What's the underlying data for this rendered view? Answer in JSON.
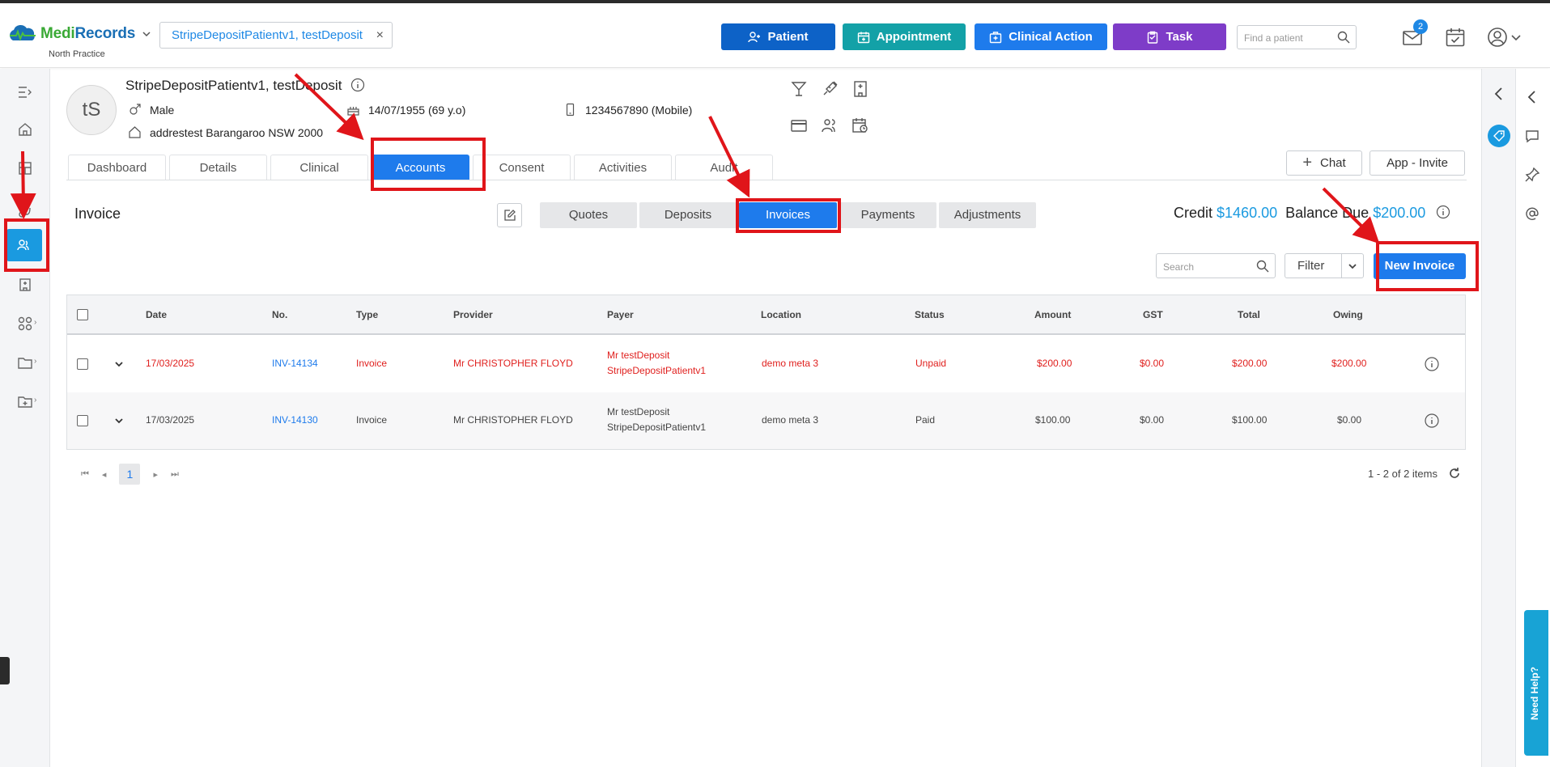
{
  "header": {
    "brand_medi": "Medi",
    "brand_records": "Records",
    "practice": "North Practice",
    "patient_chip": "StripeDepositPatientv1, testDeposit",
    "buttons": {
      "patient": "Patient",
      "appointment": "Appointment",
      "clinical_action": "Clinical Action",
      "task": "Task"
    },
    "find_placeholder": "Find a patient",
    "mail_badge": "2"
  },
  "patient": {
    "initials": "tS",
    "name": "StripeDepositPatientv1, testDeposit",
    "gender": "Male",
    "dob": "14/07/1955 (69 y.o)",
    "phone": "1234567890 (Mobile)",
    "address": "addrestest Barangaroo NSW 2000"
  },
  "tabs": [
    "Dashboard",
    "Details",
    "Clinical",
    "Accounts",
    "Consent",
    "Activities",
    "Audit"
  ],
  "active_tab": "Accounts",
  "actions": {
    "chat": "Chat",
    "app_invite": "App - Invite"
  },
  "invoice": {
    "title": "Invoice",
    "subtabs": [
      "Quotes",
      "Deposits",
      "Invoices",
      "Payments",
      "Adjustments"
    ],
    "active_subtab": "Invoices",
    "credit_label": "Credit",
    "credit_value": "$1460.00",
    "balance_label": "Balance Due",
    "balance_value": "$200.00",
    "search_placeholder": "Search",
    "filter_label": "Filter",
    "new_invoice": "New Invoice"
  },
  "table": {
    "columns": [
      "Date",
      "No.",
      "Type",
      "Provider",
      "Payer",
      "Location",
      "Status",
      "Amount",
      "GST",
      "Total",
      "Owing"
    ],
    "rows": [
      {
        "date": "17/03/2025",
        "no": "INV-14134",
        "type": "Invoice",
        "provider": "Mr CHRISTOPHER FLOYD",
        "payer_line1": "Mr testDeposit",
        "payer_line2": "StripeDepositPatientv1",
        "location": "demo meta 3",
        "status": "Unpaid",
        "amount": "$200.00",
        "gst": "$0.00",
        "total": "$200.00",
        "owing": "$200.00"
      },
      {
        "date": "17/03/2025",
        "no": "INV-14130",
        "type": "Invoice",
        "provider": "Mr CHRISTOPHER FLOYD",
        "payer_line1": "Mr testDeposit",
        "payer_line2": "StripeDepositPatientv1",
        "location": "demo meta 3",
        "status": "Paid",
        "amount": "$100.00",
        "gst": "$0.00",
        "total": "$100.00",
        "owing": "$0.00"
      }
    ]
  },
  "pagination": {
    "current_page": "1",
    "items_text": "1 - 2 of 2 items"
  },
  "need_help": "Need Help?",
  "colors": {
    "primary": "#1e7bec",
    "patient_btn": "#0d62c7",
    "appointment_btn": "#13a1a7",
    "task_btn": "#7e3cc8",
    "unpaid_red": "#e0201e",
    "annotation_red": "#e0151a",
    "accent_cyan": "#1a9ae0"
  }
}
